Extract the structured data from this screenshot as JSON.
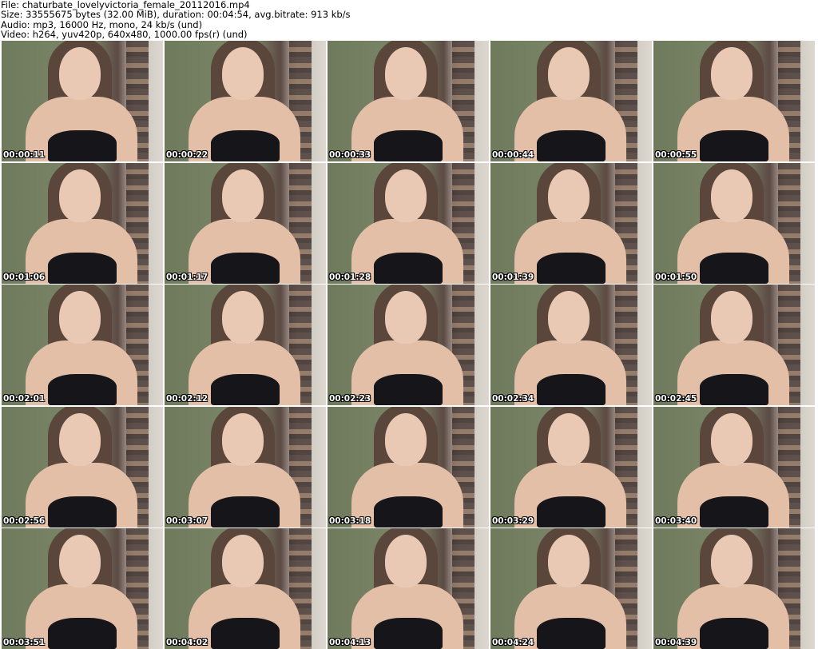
{
  "info": {
    "file": "File: chaturbate_lovelyvictoria_female_20112016.mp4",
    "size": "Size: 33555675 bytes (32.00 MiB), duration: 00:04:54, avg.bitrate: 913 kb/s",
    "audio": "Audio: mp3, 16000 Hz, mono, 24 kb/s (und)",
    "video": "Video: h264, yuv420p, 640x480, 1000.00 fps(r) (und)"
  },
  "thumbnails": [
    "00:00:11",
    "00:00:22",
    "00:00:33",
    "00:00:44",
    "00:00:55",
    "00:01:06",
    "00:01:17",
    "00:01:28",
    "00:01:39",
    "00:01:50",
    "00:02:01",
    "00:02:12",
    "00:02:23",
    "00:02:34",
    "00:02:45",
    "00:02:56",
    "00:03:07",
    "00:03:18",
    "00:03:29",
    "00:03:40",
    "00:03:51",
    "00:04:02",
    "00:04:13",
    "00:04:24",
    "00:04:39"
  ]
}
